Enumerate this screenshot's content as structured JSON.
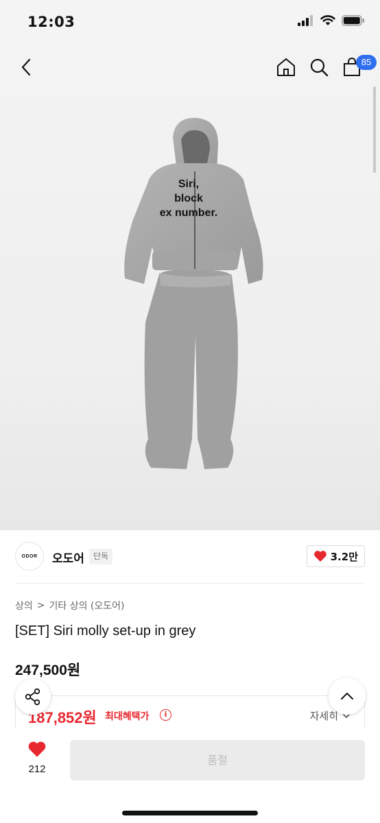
{
  "status_bar": {
    "time": "12:03"
  },
  "nav": {
    "cart_count": "85"
  },
  "product_image": {
    "print_lines": [
      "Siri,",
      "block",
      "ex number."
    ]
  },
  "shop": {
    "logo_text": "ODOR",
    "name": "오도어",
    "tag": "단독",
    "likes": "3.2만"
  },
  "breadcrumb": [
    "상의",
    ">",
    "기타 상의 (오도어)"
  ],
  "product": {
    "title": "[SET] Siri molly set-up in grey",
    "price": "247,500원"
  },
  "benefit": {
    "price": "187,852원",
    "label": "최대혜택가",
    "info_icon": "i",
    "detail_label": "자세히"
  },
  "bottom": {
    "wish_count": "212",
    "action_label": "품절"
  },
  "colors": {
    "accent_red": "#e8282f",
    "badge_blue": "#2f6fef"
  }
}
